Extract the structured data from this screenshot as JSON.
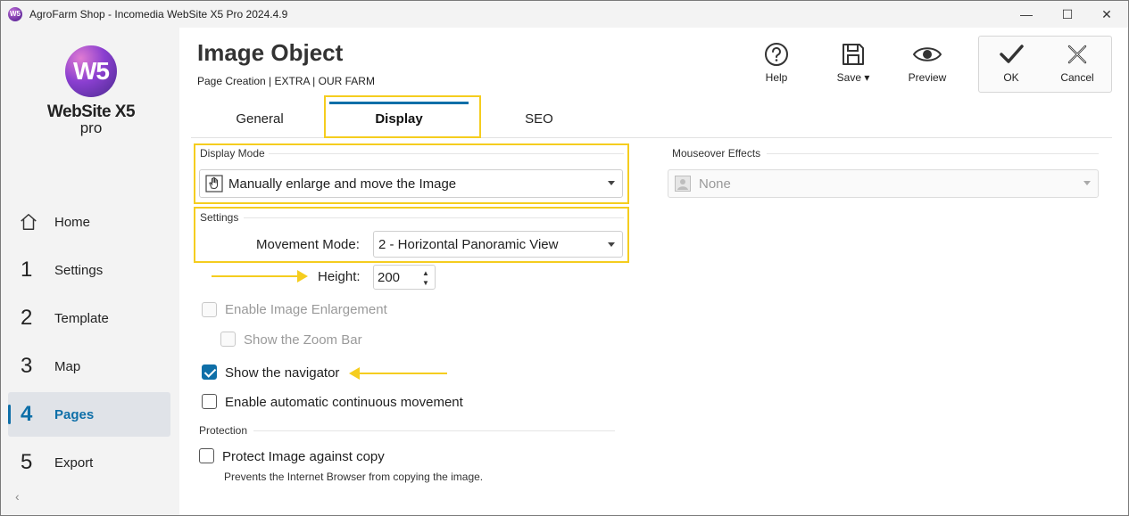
{
  "window": {
    "title": "AgroFarm Shop - Incomedia WebSite X5 Pro 2024.4.9",
    "icon_label": "W5",
    "minimize": "—",
    "maximize": "☐",
    "close": "✕"
  },
  "logo": {
    "mark": "W5",
    "name": "WebSite X5",
    "edition": "pro"
  },
  "sidebar": {
    "items": [
      {
        "num": "",
        "label": "Home"
      },
      {
        "num": "1",
        "label": "Settings"
      },
      {
        "num": "2",
        "label": "Template"
      },
      {
        "num": "3",
        "label": "Map"
      },
      {
        "num": "4",
        "label": "Pages"
      },
      {
        "num": "5",
        "label": "Export"
      }
    ],
    "collapse": "‹"
  },
  "header": {
    "title": "Image Object",
    "breadcrumb": "Page Creation | EXTRA | OUR FARM"
  },
  "toolbar": {
    "help": "Help",
    "save": "Save ▾",
    "preview": "Preview",
    "ok": "OK",
    "cancel": "Cancel"
  },
  "tabs": [
    {
      "label": "General"
    },
    {
      "label": "Display"
    },
    {
      "label": "SEO"
    }
  ],
  "display_mode": {
    "group_label": "Display Mode",
    "value": "Manually enlarge and move the Image"
  },
  "settings": {
    "group_label": "Settings",
    "movement_label": "Movement Mode:",
    "movement_value": "2 - Horizontal Panoramic View",
    "height_label": "Height:",
    "height_value": "200"
  },
  "options": {
    "enable_enlargement": "Enable Image Enlargement",
    "show_zoom_bar": "Show the Zoom Bar",
    "show_navigator": "Show the navigator",
    "auto_movement": "Enable automatic continuous movement"
  },
  "protection": {
    "group_label": "Protection",
    "protect_label": "Protect Image against copy",
    "protect_desc": "Prevents the Internet Browser from copying the image."
  },
  "mouseover": {
    "group_label": "Mouseover Effects",
    "value": "None"
  }
}
